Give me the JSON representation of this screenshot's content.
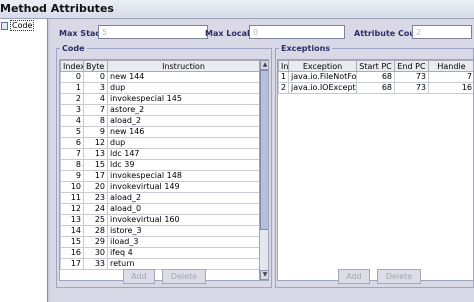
{
  "window": {
    "title": "Method Attributes"
  },
  "tree": {
    "item": "Code"
  },
  "fields": {
    "max_stack": {
      "label": "Max Stack",
      "value": "5"
    },
    "max_locals": {
      "label": "Max Locals",
      "value": "0"
    },
    "attribute_count": {
      "label": "Attribute Count",
      "value": "2"
    }
  },
  "code": {
    "legend": "Code",
    "columns": [
      "Index",
      "Byte ...",
      "Instruction"
    ],
    "rows": [
      [
        "0",
        "0",
        "new 144"
      ],
      [
        "1",
        "3",
        "dup"
      ],
      [
        "2",
        "4",
        "invokespecial 145"
      ],
      [
        "3",
        "7",
        "astore_2"
      ],
      [
        "4",
        "8",
        "aload_2"
      ],
      [
        "5",
        "9",
        "new 146"
      ],
      [
        "6",
        "12",
        "dup"
      ],
      [
        "7",
        "13",
        "ldc 147"
      ],
      [
        "8",
        "15",
        "ldc 39"
      ],
      [
        "9",
        "17",
        "invokespecial 148"
      ],
      [
        "10",
        "20",
        "invokevirtual 149"
      ],
      [
        "11",
        "23",
        "aload_2"
      ],
      [
        "12",
        "24",
        "aload_0"
      ],
      [
        "13",
        "25",
        "invokevirtual 160"
      ],
      [
        "14",
        "28",
        "istore_3"
      ],
      [
        "15",
        "29",
        "iload_3"
      ],
      [
        "16",
        "30",
        "ifeq 4"
      ],
      [
        "17",
        "33",
        "return"
      ]
    ],
    "buttons": {
      "add": "Add",
      "delete": "Delete"
    }
  },
  "exceptions": {
    "legend": "Exceptions",
    "columns": [
      "In...",
      "Exception",
      "Start PC",
      "End PC",
      "Handle"
    ],
    "rows": [
      [
        "1",
        "java.io.FileNotFoundEx...",
        "68",
        "73",
        "7"
      ],
      [
        "2",
        "java.io.IOException",
        "68",
        "73",
        "16"
      ]
    ],
    "buttons": {
      "add": "Add",
      "delete": "Delete"
    }
  }
}
